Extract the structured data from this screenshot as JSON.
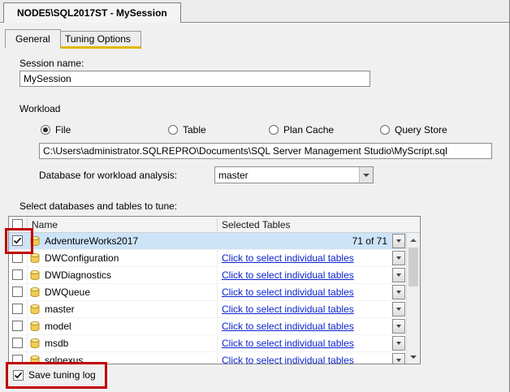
{
  "window": {
    "tab_title": "NODE5\\SQL2017ST - MySession"
  },
  "tabs": {
    "general": "General",
    "tuning_options": "Tuning Options"
  },
  "session": {
    "label": "Session name:",
    "value": "MySession"
  },
  "workload": {
    "label": "Workload",
    "options": [
      {
        "label": "File",
        "selected": true
      },
      {
        "label": "Table",
        "selected": false
      },
      {
        "label": "Plan Cache",
        "selected": false
      },
      {
        "label": "Query Store",
        "selected": false
      }
    ],
    "file_path": "C:\\Users\\administrator.SQLREPRO\\Documents\\SQL Server Management Studio\\MyScript.sql",
    "database_label": "Database for workload analysis:",
    "database_value": "master"
  },
  "tune_table": {
    "label": "Select databases and tables to tune:",
    "columns": {
      "name": "Name",
      "selected_tables": "Selected Tables"
    },
    "rows": [
      {
        "name": "AdventureWorks2017",
        "checked": true,
        "selected_tables": "71 of 71"
      },
      {
        "name": "DWConfiguration",
        "checked": false,
        "selected_tables": "Click to select individual tables"
      },
      {
        "name": "DWDiagnostics",
        "checked": false,
        "selected_tables": "Click to select individual tables"
      },
      {
        "name": "DWQueue",
        "checked": false,
        "selected_tables": "Click to select individual tables"
      },
      {
        "name": "master",
        "checked": false,
        "selected_tables": "Click to select individual tables"
      },
      {
        "name": "model",
        "checked": false,
        "selected_tables": "Click to select individual tables"
      },
      {
        "name": "msdb",
        "checked": false,
        "selected_tables": "Click to select individual tables"
      },
      {
        "name": "sqlnexus",
        "checked": false,
        "selected_tables": "Click to select individual tables"
      }
    ]
  },
  "footer": {
    "save_tuning_log": "Save tuning log",
    "checked": true
  },
  "colors": {
    "tab_accent": "#e3b505",
    "annotation": "#c00000",
    "link": "#0b23cd",
    "selected_row": "#cde3f7"
  }
}
